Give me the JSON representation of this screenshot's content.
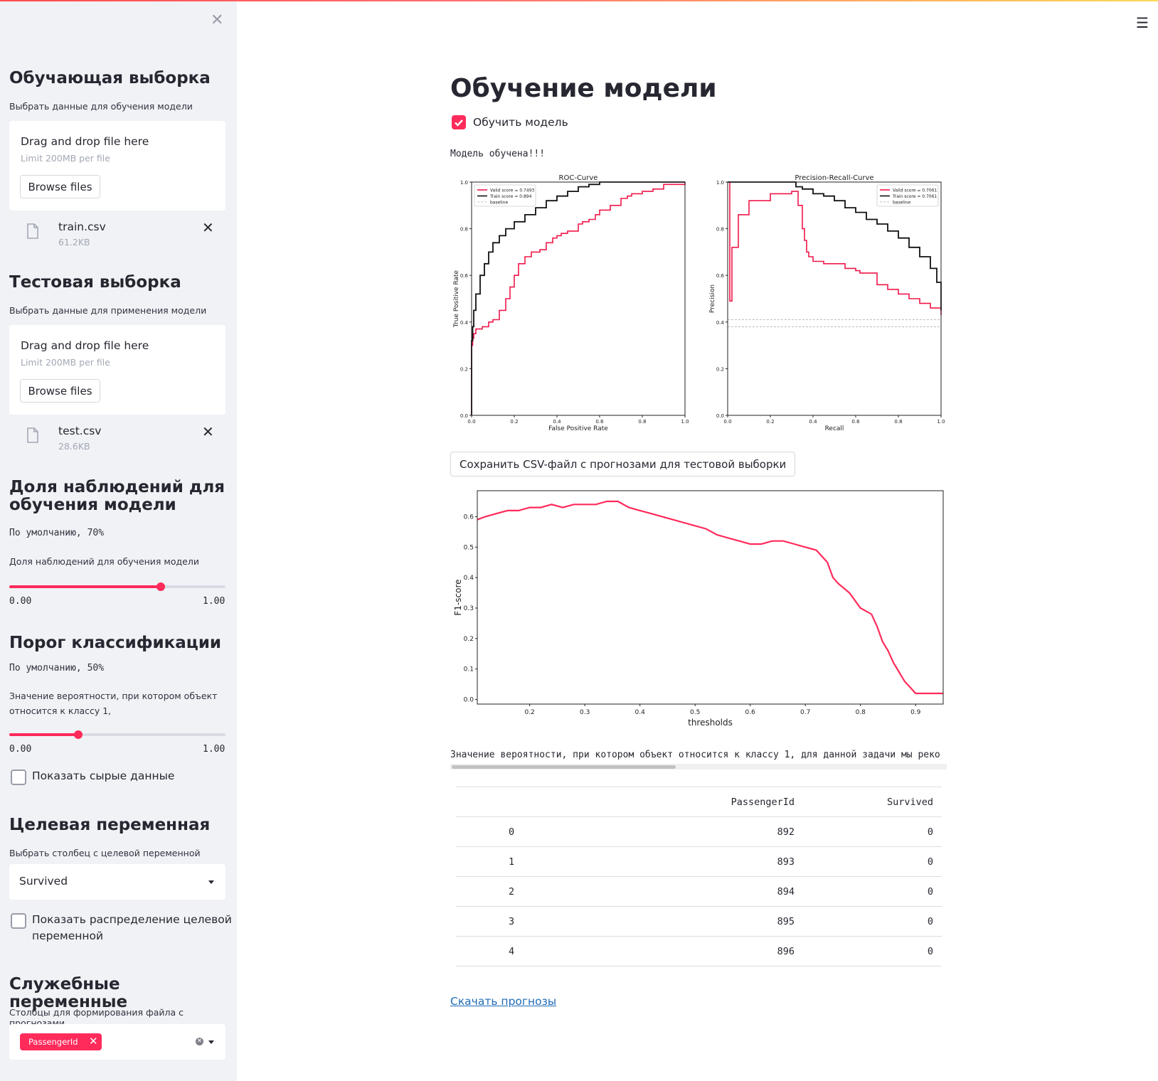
{
  "sidebar": {
    "train": {
      "heading": "Обучающая выборка",
      "caption": "Выбрать данные для обучения модели",
      "drop_text": "Drag and drop file here",
      "limit_text": "Limit 200MB per file",
      "browse_label": "Browse files",
      "file_name": "train.csv",
      "file_size": "61.2KB"
    },
    "test": {
      "heading": "Тестовая выборка",
      "caption": "Выбрать данные для применения модели",
      "drop_text": "Drag and drop file here",
      "limit_text": "Limit 200MB per file",
      "browse_label": "Browse files",
      "file_name": "test.csv",
      "file_size": "28.6KB"
    },
    "split": {
      "heading_line1": "Доля наблюдений для",
      "heading_line2": "обучения модели",
      "default_note": "По умолчанию, 70%",
      "slider_label": "Доля наблюдений для обучения модели",
      "min": "0.00",
      "max": "1.00",
      "value": 0.7
    },
    "threshold": {
      "heading": "Порог классификации",
      "default_note": "По умолчанию, 50%",
      "slider_label_line1": "Значение вероятности, при котором объект",
      "slider_label_line2": "относится к классу 1,",
      "min": "0.00",
      "max": "1.00",
      "value": 0.32
    },
    "show_raw": {
      "label": "Показать сырые данные",
      "checked": false
    },
    "target": {
      "heading": "Целевая переменная",
      "caption": "Выбрать столбец с целевой переменной",
      "selected": "Survived"
    },
    "show_dist": {
      "label_line1": "Показать распределение целевой",
      "label_line2": "переменной",
      "checked": false
    },
    "service": {
      "heading": "Служебные переменные",
      "caption": "Столбцы для формирования файла с прогнозами",
      "chip": "PassengerId"
    }
  },
  "main": {
    "title": "Обучение модели",
    "train_checkbox": {
      "label": "Обучить модель",
      "checked": true
    },
    "status": "Модель обучена!!!",
    "save_button": "Сохранить CSV-файл с прогнозами для тестовой выборки",
    "recommendation": "Значение вероятности, при котором объект относится к классу 1, для данной задачи мы реко",
    "table": {
      "columns": [
        "",
        "PassengerId",
        "Survived"
      ],
      "rows": [
        [
          "0",
          "892",
          "0"
        ],
        [
          "1",
          "893",
          "0"
        ],
        [
          "2",
          "894",
          "0"
        ],
        [
          "3",
          "895",
          "0"
        ],
        [
          "4",
          "896",
          "0"
        ]
      ]
    },
    "download_link": "Скачать прогнозы"
  },
  "colors": {
    "accent": "#ff2b5b",
    "valid_line": "#f0184a",
    "train_line": "#111111"
  },
  "chart_data": [
    {
      "type": "line",
      "title": "ROC-Curve",
      "xlabel": "False Positive Rate",
      "ylabel": "True Positive Rate",
      "xlim": [
        0,
        1
      ],
      "ylim": [
        0,
        1
      ],
      "xticks": [
        "0.0",
        "0.2",
        "0.4",
        "0.6",
        "0.8",
        "1.0"
      ],
      "yticks": [
        "0.0",
        "0.2",
        "0.4",
        "0.6",
        "0.8",
        "1.0"
      ],
      "legend": [
        "Valid score = 0.7493",
        "Train score = 0.894",
        "baseline"
      ],
      "legend_position": "top-left",
      "series": [
        {
          "name": "Valid score = 0.7493",
          "x": [
            0,
            0,
            0.005,
            0.01,
            0.02,
            0.05,
            0.08,
            0.1,
            0.13,
            0.16,
            0.18,
            0.2,
            0.22,
            0.25,
            0.28,
            0.32,
            0.35,
            0.38,
            0.4,
            0.42,
            0.45,
            0.5,
            0.52,
            0.55,
            0.58,
            0.6,
            0.65,
            0.7,
            0.73,
            0.75,
            0.8,
            0.85,
            0.9,
            0.95,
            1.0
          ],
          "y": [
            0,
            0.3,
            0.33,
            0.35,
            0.37,
            0.38,
            0.4,
            0.41,
            0.45,
            0.5,
            0.55,
            0.6,
            0.65,
            0.68,
            0.7,
            0.71,
            0.74,
            0.76,
            0.77,
            0.78,
            0.79,
            0.82,
            0.83,
            0.84,
            0.86,
            0.88,
            0.9,
            0.93,
            0.94,
            0.95,
            0.96,
            0.97,
            0.99,
            0.99,
            1.0
          ]
        },
        {
          "name": "Train score = 0.894",
          "x": [
            0,
            0,
            0.005,
            0.01,
            0.02,
            0.04,
            0.06,
            0.08,
            0.1,
            0.13,
            0.16,
            0.2,
            0.25,
            0.3,
            0.35,
            0.4,
            0.45,
            0.5,
            0.55,
            0.6,
            0.65,
            0.7,
            0.75,
            0.8,
            0.9,
            1.0
          ],
          "y": [
            0,
            0.32,
            0.38,
            0.45,
            0.52,
            0.6,
            0.65,
            0.7,
            0.74,
            0.77,
            0.8,
            0.83,
            0.86,
            0.89,
            0.92,
            0.94,
            0.96,
            0.98,
            0.99,
            1.0,
            1.0,
            1.0,
            1.0,
            1.0,
            1.0,
            1.0
          ]
        },
        {
          "name": "baseline",
          "x": [
            0,
            1
          ],
          "y": [
            0,
            1
          ]
        }
      ]
    },
    {
      "type": "line",
      "title": "Precision-Recall-Curve",
      "xlabel": "Recall",
      "ylabel": "Precision",
      "xlim": [
        0,
        1
      ],
      "ylim": [
        0,
        1
      ],
      "xticks": [
        "0.0",
        "0.2",
        "0.4",
        "0.6",
        "0.8",
        "1.0"
      ],
      "yticks": [
        "0.0",
        "0.2",
        "0.4",
        "0.6",
        "0.8",
        "1.0"
      ],
      "legend": [
        "Valid score = 0.7061",
        "Train score = 0.7061",
        "baseline"
      ],
      "legend_position": "top-right",
      "series": [
        {
          "name": "Valid score = 0.7061",
          "x": [
            0.005,
            0.01,
            0.02,
            0.05,
            0.1,
            0.2,
            0.3,
            0.33,
            0.35,
            0.36,
            0.37,
            0.38,
            0.4,
            0.45,
            0.5,
            0.55,
            0.6,
            0.62,
            0.7,
            0.75,
            0.8,
            0.85,
            0.9,
            0.95,
            1.0
          ],
          "y": [
            1.0,
            0.49,
            0.72,
            0.86,
            0.92,
            0.95,
            0.96,
            0.9,
            0.8,
            0.75,
            0.7,
            0.68,
            0.66,
            0.65,
            0.65,
            0.63,
            0.62,
            0.61,
            0.56,
            0.54,
            0.52,
            0.5,
            0.48,
            0.46,
            0.43
          ]
        },
        {
          "name": "Train score = 0.7061",
          "x": [
            0,
            0.1,
            0.2,
            0.3,
            0.32,
            0.35,
            0.4,
            0.45,
            0.5,
            0.55,
            0.6,
            0.65,
            0.7,
            0.75,
            0.8,
            0.85,
            0.9,
            0.95,
            0.98,
            1.0
          ],
          "y": [
            1.0,
            1.0,
            1.0,
            1.0,
            0.98,
            0.97,
            0.95,
            0.94,
            0.92,
            0.89,
            0.87,
            0.84,
            0.82,
            0.79,
            0.76,
            0.72,
            0.68,
            0.63,
            0.57,
            0.45
          ]
        },
        {
          "name": "baseline",
          "x": [
            0,
            1
          ],
          "y": [
            0.38,
            0.38
          ]
        },
        {
          "name": "baseline",
          "x": [
            0,
            1
          ],
          "y": [
            0.41,
            0.41
          ]
        }
      ]
    },
    {
      "type": "line",
      "xlabel": "thresholds",
      "ylabel": "F1-score",
      "xlim": [
        0.105,
        0.95
      ],
      "ylim": [
        -0.015,
        0.685
      ],
      "xticks": [
        "0.2",
        "0.3",
        "0.4",
        "0.5",
        "0.6",
        "0.7",
        "0.8",
        "0.9"
      ],
      "yticks": [
        "0.0",
        "0.1",
        "0.2",
        "0.3",
        "0.4",
        "0.5",
        "0.6"
      ],
      "series": [
        {
          "x": [
            0.105,
            0.12,
            0.14,
            0.16,
            0.18,
            0.2,
            0.22,
            0.24,
            0.26,
            0.28,
            0.3,
            0.32,
            0.34,
            0.36,
            0.38,
            0.4,
            0.42,
            0.44,
            0.46,
            0.48,
            0.5,
            0.52,
            0.54,
            0.56,
            0.58,
            0.6,
            0.62,
            0.64,
            0.66,
            0.68,
            0.7,
            0.72,
            0.74,
            0.75,
            0.76,
            0.78,
            0.8,
            0.82,
            0.83,
            0.84,
            0.85,
            0.86,
            0.87,
            0.88,
            0.89,
            0.9,
            0.92,
            0.95
          ],
          "y": [
            0.59,
            0.6,
            0.61,
            0.62,
            0.62,
            0.63,
            0.63,
            0.64,
            0.63,
            0.64,
            0.64,
            0.64,
            0.65,
            0.65,
            0.63,
            0.62,
            0.61,
            0.6,
            0.59,
            0.58,
            0.57,
            0.56,
            0.54,
            0.53,
            0.52,
            0.51,
            0.51,
            0.52,
            0.52,
            0.51,
            0.5,
            0.49,
            0.45,
            0.4,
            0.38,
            0.35,
            0.3,
            0.28,
            0.24,
            0.19,
            0.16,
            0.12,
            0.09,
            0.06,
            0.04,
            0.02,
            0.02,
            0.02
          ]
        }
      ]
    }
  ]
}
